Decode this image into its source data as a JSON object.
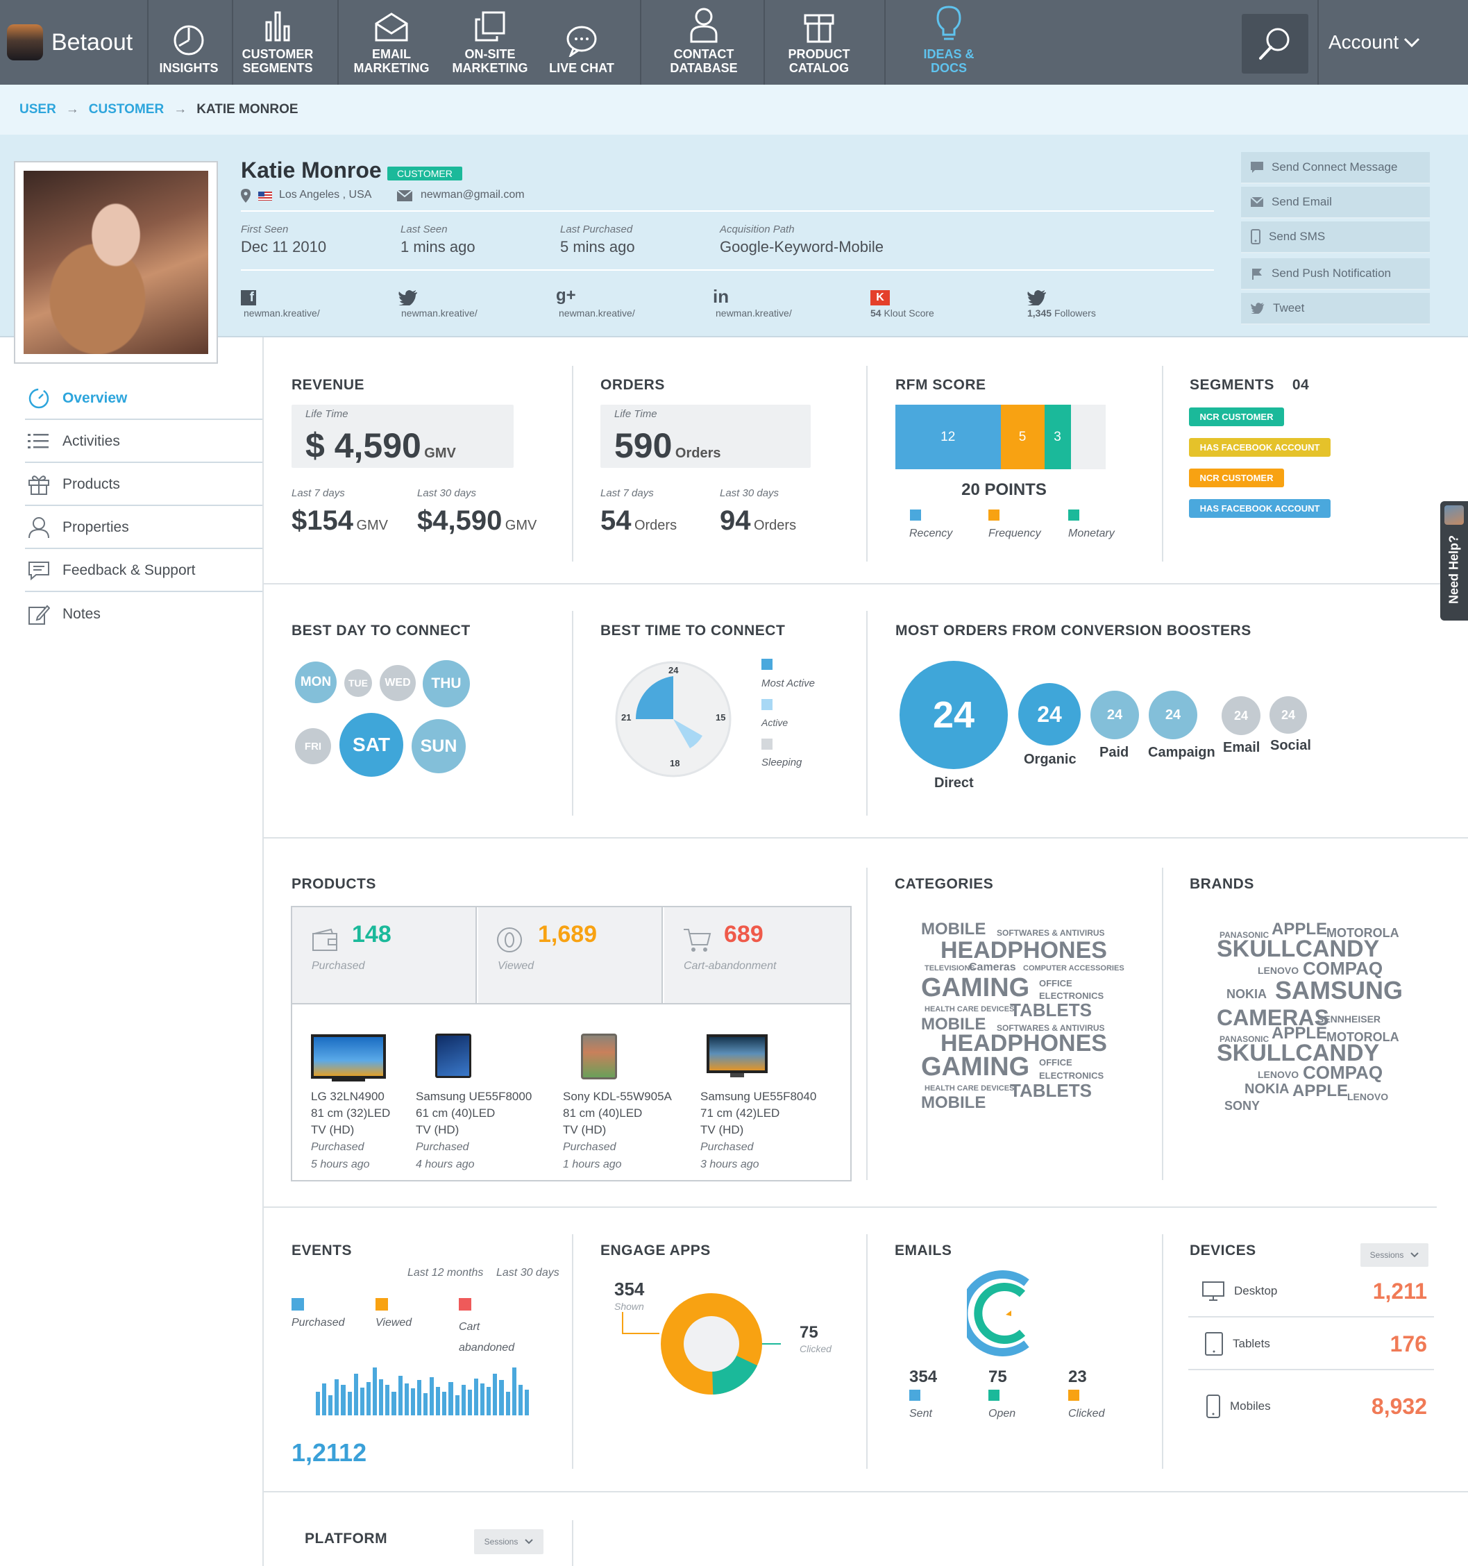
{
  "nav": {
    "logo": "Betaout",
    "items": [
      {
        "label1": "INSIGHTS",
        "label2": ""
      },
      {
        "label1": "CUSTOMER",
        "label2": "SEGMENTS"
      },
      {
        "label1": "EMAIL",
        "label2": "MARKETING"
      },
      {
        "label1": "ON-SITE",
        "label2": "MARKETING"
      },
      {
        "label1": "LIVE CHAT",
        "label2": ""
      },
      {
        "label1": "CONTACT",
        "label2": "DATABASE"
      },
      {
        "label1": "PRODUCT",
        "label2": "CATALOG"
      },
      {
        "label1": "IDEAS &",
        "label2": "DOCS"
      }
    ],
    "account": "Account",
    "active_color": "#5fc3ee"
  },
  "breadcrumb": [
    "USER",
    "CUSTOMER",
    "KATIE MONROE"
  ],
  "profile": {
    "name": "Katie Monroe",
    "badge": "CUSTOMER",
    "location": "Los Angeles , USA",
    "email": "newman@gmail.com",
    "stats": [
      {
        "label": "First Seen",
        "value": "Dec 11 2010"
      },
      {
        "label": "Last Seen",
        "value": "1 mins ago"
      },
      {
        "label": "Last Purchased",
        "value": "5 mins ago"
      },
      {
        "label": "Acquisition Path",
        "value": "Google-Keyword-Mobile"
      }
    ],
    "social": [
      {
        "icon": "facebook-icon",
        "text": "newman.kreative/"
      },
      {
        "icon": "twitter-icon",
        "text": "newman.kreative/"
      },
      {
        "icon": "google-plus-icon",
        "text": "newman.kreative/"
      },
      {
        "icon": "linkedin-icon",
        "text": "newman.kreative/"
      },
      {
        "icon": "klout-icon",
        "num": "54",
        "text": "Klout Score"
      },
      {
        "icon": "twitter-icon",
        "num": "1,345",
        "text": "Followers"
      }
    ],
    "actions": [
      "Send Connect Message",
      "Send Email",
      "Send SMS",
      "Send Push Notification",
      "Tweet"
    ]
  },
  "menu": [
    "Overview",
    "Activities",
    "Products",
    "Properties",
    "Feedback & Support",
    "Notes"
  ],
  "revenue": {
    "title": "REVENUE",
    "lifetime_label": "Life Time",
    "lifetime": "$ 4,590",
    "lifetime_unit": "GMV",
    "l7_label": "Last 7 days",
    "l7": "$154",
    "l7_unit": "GMV",
    "l30_label": "Last 30 days",
    "l30": "$4,590",
    "l30_unit": "GMV"
  },
  "orders": {
    "title": "ORDERS",
    "lifetime_label": "Life Time",
    "lifetime": "590",
    "lifetime_unit": "Orders",
    "l7_label": "Last 7 days",
    "l7": "54",
    "l7_unit": "Orders",
    "l30_label": "Last 30 days",
    "l30": "94",
    "l30_unit": "Orders"
  },
  "rfm": {
    "title": "RFM SCORE",
    "points": "20 POINTS",
    "parts": [
      {
        "label": "Recency",
        "value": 12,
        "color": "#4aa8dd"
      },
      {
        "label": "Frequency",
        "value": 5,
        "color": "#f8a212"
      },
      {
        "label": "Monetary",
        "value": 3,
        "color": "#1bb99a"
      }
    ]
  },
  "segments": {
    "title": "SEGMENTS",
    "count": "04",
    "items": [
      {
        "label": "NCR CUSTOMER",
        "color": "#1bb99a"
      },
      {
        "label": "HAS FACEBOOK ACCOUNT",
        "color": "#e5c22a"
      },
      {
        "label": "NCR CUSTOMER",
        "color": "#f8a212"
      },
      {
        "label": "HAS FACEBOOK ACCOUNT",
        "color": "#4aa8dd"
      }
    ]
  },
  "best_day": {
    "title": "BEST DAY TO CONNECT",
    "days": [
      "MON",
      "TUE",
      "WED",
      "THU",
      "FRI",
      "SAT",
      "SUN"
    ]
  },
  "best_time": {
    "title": "BEST TIME TO CONNECT",
    "ticks": [
      "24",
      "15",
      "18",
      "21"
    ],
    "legend": [
      {
        "label": "Most Active",
        "color": "#4aa8dd"
      },
      {
        "label": "Active",
        "color": "#a8d8f5"
      },
      {
        "label": "Sleeping",
        "color": "#d4d8dc"
      }
    ]
  },
  "boosters": {
    "title": "MOST ORDERS FROM CONVERSION BOOSTERS",
    "items": [
      {
        "label": "Direct",
        "value": "24"
      },
      {
        "label": "Organic",
        "value": "24"
      },
      {
        "label": "Paid",
        "value": "24"
      },
      {
        "label": "Campaign",
        "value": "24"
      },
      {
        "label": "Email",
        "value": "24"
      },
      {
        "label": "Social",
        "value": "24"
      }
    ]
  },
  "products": {
    "title": "PRODUCTS",
    "stats": [
      {
        "value": "148",
        "label": "Purchased",
        "color": "#1bb99a"
      },
      {
        "value": "1,689",
        "label": "Viewed",
        "color": "#f8a212"
      },
      {
        "value": "689",
        "label": "Cart-abandonment",
        "color": "#ef5a4a"
      }
    ],
    "items": [
      {
        "l1": "LG 32LN4900",
        "l2": "81 cm (32)LED",
        "l3": "TV (HD)",
        "status": "Purchased",
        "time": "5 hours ago"
      },
      {
        "l1": "Samsung UE55F8000",
        "l2": "61 cm (40)LED",
        "l3": "TV (HD)",
        "status": "Purchased",
        "time": "4 hours ago"
      },
      {
        "l1": "Sony KDL-55W905A",
        "l2": "81 cm (40)LED",
        "l3": "TV (HD)",
        "status": "Purchased",
        "time": "1 hours ago"
      },
      {
        "l1": "Samsung UE55F8040",
        "l2": "71 cm (42)LED",
        "l3": "TV (HD)",
        "status": "Purchased",
        "time": "3 hours ago"
      }
    ]
  },
  "categories": {
    "title": "CATEGORIES",
    "words": [
      "MOBILE",
      "SOFTWARES & ANTIVIRUS",
      "HEADPHONES",
      "TELEVISIONS",
      "Cameras",
      "COMPUTER ACCESSORIES",
      "GAMING",
      "OFFICE",
      "ELECTRONICS",
      "HEALTH CARE DEVICES",
      "TABLETS",
      "MOBILE",
      "SOFTWARES & ANTIVIRUS",
      "HEADPHONES",
      "GAMING",
      "OFFICE",
      "ELECTRONICS",
      "HEALTH CARE DEVICES",
      "TABLETS",
      "MOBILE"
    ]
  },
  "brands": {
    "title": "BRANDS",
    "words": [
      "PANASONIC",
      "APPLE",
      "MOTOROLA",
      "SKULLCANDY",
      "LENOVO",
      "COMPAQ",
      "NOKIA",
      "SAMSUNG",
      "CAMERAS",
      "SENNHEISER",
      "PANASONIC",
      "APPLE",
      "MOTOROLA",
      "SKULLCANDY",
      "LENOVO",
      "COMPAQ",
      "NOKIA",
      "APPLE",
      "LENOVO",
      "SONY"
    ]
  },
  "events": {
    "title": "EVENTS",
    "tabs": [
      "Last 12 months",
      "Last 30 days"
    ],
    "legend": [
      {
        "label": "Purchased",
        "color": "#4aa8dd"
      },
      {
        "label": "Viewed",
        "color": "#f8a212"
      },
      {
        "label": "Cart abandoned",
        "color": "#ef5a5a"
      }
    ],
    "total": "1,2112"
  },
  "engage": {
    "title": "ENGAGE APPS",
    "shown": 354,
    "shown_label": "Shown",
    "clicked": 75,
    "clicked_label": "Clicked"
  },
  "emails": {
    "title": "EMAILS",
    "items": [
      {
        "value": 354,
        "label": "Sent",
        "color": "#4aa8dd"
      },
      {
        "value": 75,
        "label": "Open",
        "color": "#1bb99a"
      },
      {
        "value": 23,
        "label": "Clicked",
        "color": "#f8a212"
      }
    ]
  },
  "devices": {
    "title": "DEVICES",
    "dropdown": "Sessions",
    "items": [
      {
        "label": "Desktop",
        "value": "1,211"
      },
      {
        "label": "Tablets",
        "value": "176"
      },
      {
        "label": "Mobiles",
        "value": "8,932"
      }
    ]
  },
  "platform": {
    "title": "PLATFORM",
    "dropdown": "Sessions"
  },
  "help": "Need Help?"
}
